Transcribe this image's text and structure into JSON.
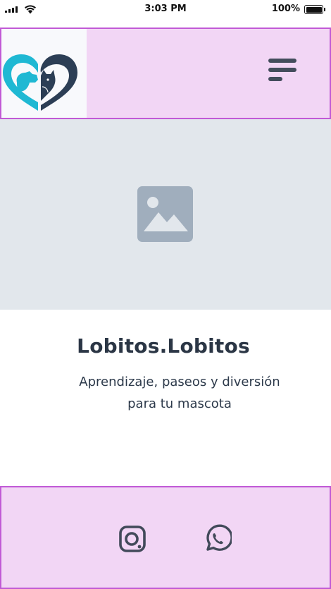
{
  "status_bar": {
    "time": "3:03 PM",
    "battery_percent": "100%"
  },
  "header": {
    "logo_icon": "heart-with-pets-logo",
    "menu_icon": "hamburger-menu-icon"
  },
  "hero": {
    "placeholder_icon": "image-placeholder-icon"
  },
  "content": {
    "title": "Lobitos.Lobitos",
    "tagline_line1": "Aprendizaje, paseos y diversión",
    "tagline_line2": "para tu mascota"
  },
  "footer": {
    "social_icons": [
      "instagram-icon",
      "whatsapp-icon"
    ]
  },
  "colors": {
    "header_bg": "#f2d6f5",
    "header_border": "#c15ad6",
    "hero_bg": "#e2e7ec",
    "logo_cyan": "#1fb8d3",
    "logo_navy": "#2c3e55",
    "text_dark": "#2b3645"
  }
}
